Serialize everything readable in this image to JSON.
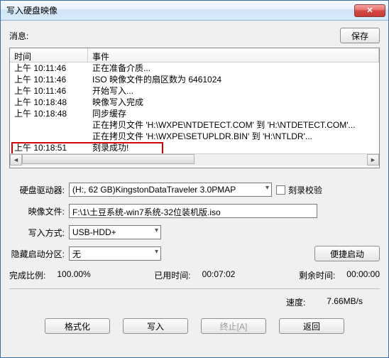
{
  "window": {
    "title": "写入硬盘映像"
  },
  "message": {
    "label": "消息:",
    "save": "保存"
  },
  "log": {
    "headers": {
      "time": "时间",
      "event": "事件"
    },
    "rows": [
      {
        "t": "上午 10:11:46",
        "e": "正在准备介质..."
      },
      {
        "t": "上午 10:11:46",
        "e": "ISO 映像文件的扇区数为 6461024"
      },
      {
        "t": "上午 10:11:46",
        "e": "开始写入..."
      },
      {
        "t": "上午 10:18:48",
        "e": "映像写入完成"
      },
      {
        "t": "上午 10:18:48",
        "e": "同步缓存"
      },
      {
        "t": "",
        "e": "正在拷贝文件 'H:\\WXPE\\NTDETECT.COM' 到 'H:\\NTDETECT.COM'..."
      },
      {
        "t": "",
        "e": "正在拷贝文件 'H:\\WXPE\\SETUPLDR.BIN' 到 'H:\\NTLDR'..."
      },
      {
        "t": "上午 10:18:51",
        "e": "刻录成功!"
      }
    ]
  },
  "form": {
    "drive_label": "硬盘驱动器:",
    "drive_value": "(H:, 62 GB)KingstonDataTraveler 3.0PMAP",
    "verify_label": "刻录校验",
    "image_label": "映像文件:",
    "image_value": "F:\\1\\土豆系统-win7系统-32位装机版.iso",
    "method_label": "写入方式:",
    "method_value": "USB-HDD+",
    "hidden_label": "隐藏启动分区:",
    "hidden_value": "无",
    "portable_btn": "便捷启动"
  },
  "status": {
    "done_label": "完成比例:",
    "done_value": "100.00%",
    "elapsed_label": "已用时间:",
    "elapsed_value": "00:07:02",
    "remain_label": "剩余时间:",
    "remain_value": "00:00:00",
    "speed_label": "速度:",
    "speed_value": "7.66MB/s"
  },
  "buttons": {
    "format": "格式化",
    "write": "写入",
    "abort": "终止[A]",
    "back": "返回"
  }
}
